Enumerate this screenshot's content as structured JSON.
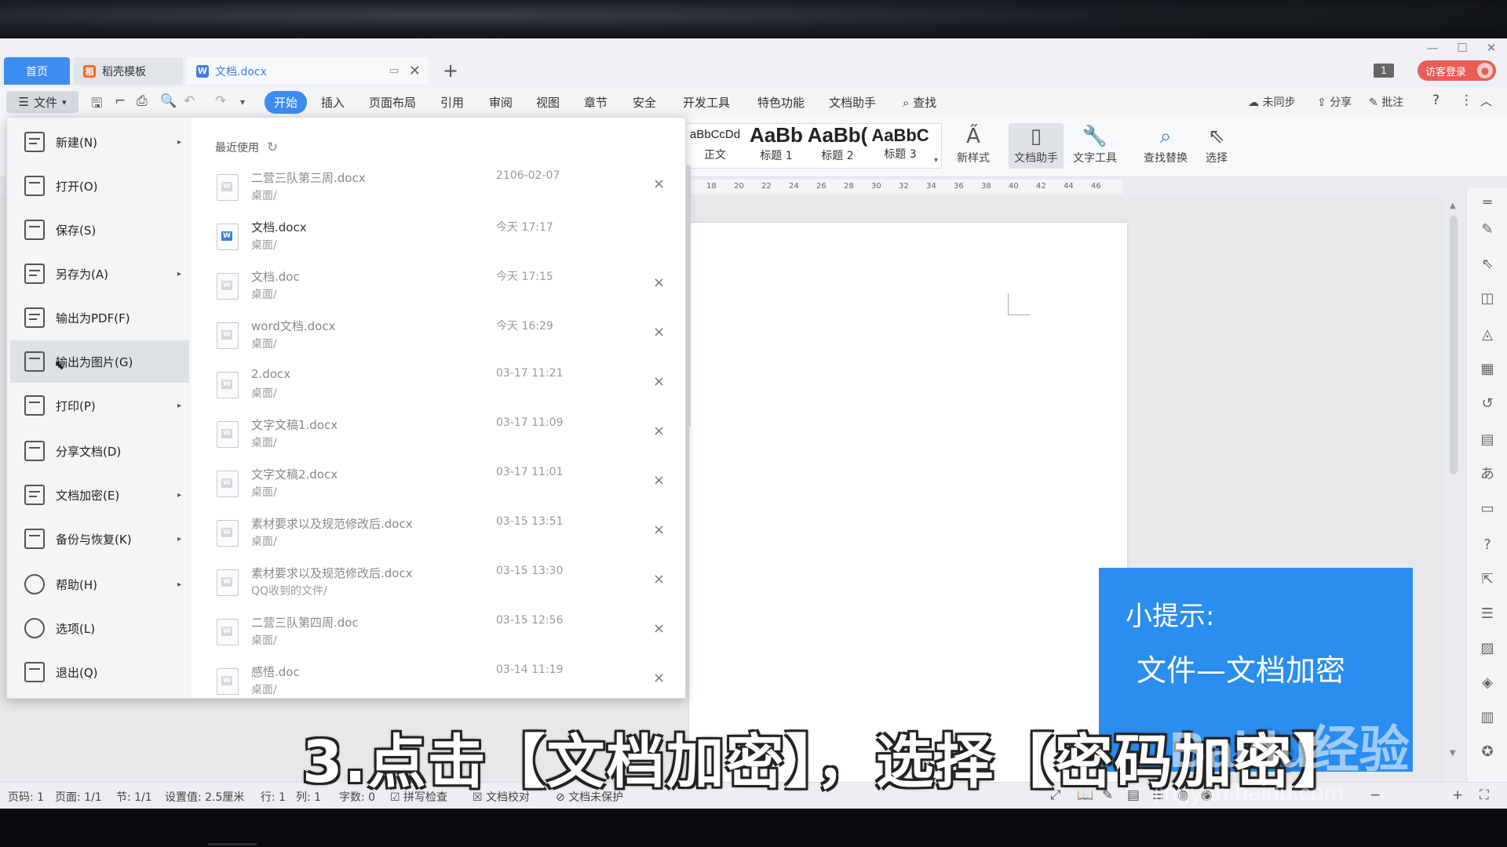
{
  "tabs": {
    "home": "首页",
    "docs": [
      {
        "label": "稻壳模板",
        "logo": "稻",
        "color": "#f06a2a"
      },
      {
        "label": "文档.docx",
        "logo": "W",
        "color": "#3d7fe0"
      }
    ],
    "add": "+",
    "page_badge": "1",
    "login": "访客登录"
  },
  "menubar": {
    "file": "文件",
    "items": [
      "开始",
      "插入",
      "页面布局",
      "引用",
      "审阅",
      "视图",
      "章节",
      "安全",
      "开发工具",
      "特色功能",
      "文档助手",
      "查找"
    ],
    "active": "开始",
    "sync": "未同步",
    "share": "分享",
    "comment": "批注"
  },
  "ribbon": {
    "styles": [
      {
        "sample": "aBbCcDd",
        "caption": "正文"
      },
      {
        "sample": "AaBb",
        "caption": "标题 1"
      },
      {
        "sample": "AaBb(",
        "caption": "标题 2"
      },
      {
        "sample": "AaBbC",
        "caption": "标题 3"
      }
    ],
    "buttons": [
      "新样式",
      "文档助手",
      "文字工具",
      "查找替换",
      "选择"
    ]
  },
  "ruler": [
    "18",
    "20",
    "22",
    "24",
    "26",
    "28",
    "30",
    "32",
    "34",
    "36",
    "38",
    "40",
    "42",
    "44",
    "46"
  ],
  "file_menu": {
    "items": [
      {
        "label": "新建(N)",
        "arrow": true
      },
      {
        "label": "打开(O)",
        "arrow": false
      },
      {
        "label": "保存(S)",
        "arrow": false
      },
      {
        "label": "另存为(A)",
        "arrow": true
      },
      {
        "label": "输出为PDF(F)",
        "arrow": false
      },
      {
        "label": "输出为图片(G)",
        "arrow": false
      },
      {
        "label": "打印(P)",
        "arrow": true
      },
      {
        "label": "分享文档(D)",
        "arrow": false
      },
      {
        "label": "文档加密(E)",
        "arrow": true
      },
      {
        "label": "备份与恢复(K)",
        "arrow": true
      },
      {
        "label": "帮助(H)",
        "arrow": true
      },
      {
        "label": "选项(L)",
        "arrow": false
      },
      {
        "label": "退出(Q)",
        "arrow": false
      }
    ],
    "recent_title": "最近使用",
    "recent": [
      {
        "name": "二营三队第三周.docx",
        "path": "桌面/",
        "date": "2106-02-07",
        "current": false
      },
      {
        "name": "文档.docx",
        "path": "桌面/",
        "date": "今天 17:17",
        "current": true
      },
      {
        "name": "文档.doc",
        "path": "桌面/",
        "date": "今天 17:15",
        "current": false
      },
      {
        "name": "word文档.docx",
        "path": "桌面/",
        "date": "今天 16:29",
        "current": false
      },
      {
        "name": "2.docx",
        "path": "桌面/",
        "date": "03-17 11:21",
        "current": false
      },
      {
        "name": "文字文稿1.docx",
        "path": "桌面/",
        "date": "03-17 11:09",
        "current": false
      },
      {
        "name": "文字文稿2.docx",
        "path": "桌面/",
        "date": "03-17 11:01",
        "current": false
      },
      {
        "name": "素材要求以及规范修改后.docx",
        "path": "桌面/",
        "date": "03-15 13:51",
        "current": false
      },
      {
        "name": "素材要求以及规范修改后.docx",
        "path": "QQ收到的文件/",
        "date": "03-15 13:30",
        "current": false
      },
      {
        "name": "二营三队第四周.doc",
        "path": "桌面/",
        "date": "03-15 12:56",
        "current": false
      },
      {
        "name": "感悟.doc",
        "path": "桌面/",
        "date": "03-14 11:19",
        "current": false
      }
    ]
  },
  "statusbar": {
    "page": "页码: 1",
    "pages": "页面: 1/1",
    "section": "节: 1/1",
    "setting": "设置值: 2.5厘米",
    "row": "行: 1",
    "col": "列: 1",
    "words": "字数: 0",
    "spell": "拼写检查",
    "proof": "文档校对",
    "protect": "文档未保护"
  },
  "tip": {
    "heading": "小提示:",
    "body": "文件—文档加密"
  },
  "caption": "3.点击【文档加密】，选择【密码加密】",
  "watermark": "Baidu经验",
  "watermark_url": "jingyan.baidu.com"
}
